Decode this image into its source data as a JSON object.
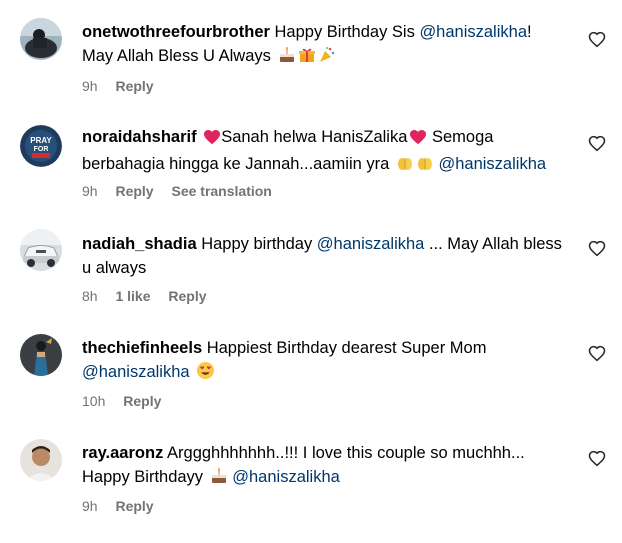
{
  "comments": [
    {
      "username": "onetwothreefourbrother",
      "text_a": "Happy Birthday Sis",
      "mention": "@haniszalikha",
      "text_b": "! May Allah Bless U Always",
      "emojis": [
        "birthday-cake",
        "wrapped-gift",
        "party-popper"
      ],
      "time": "9h",
      "reply": "Reply"
    },
    {
      "username": "noraidahsharif",
      "text_a": "Sanah helwa HanisZalika",
      "text_b": "Semoga berbahagia hingga ke Jannah...aamiin yra",
      "mention": "@haniszalikha",
      "emojis": [
        "red-heart",
        "red-heart",
        "folded-hands",
        "folded-hands"
      ],
      "time": "9h",
      "reply": "Reply",
      "translation": "See translation",
      "avatar_text_1": "PRAY",
      "avatar_text_2": "FOR"
    },
    {
      "username": "nadiah_shadia",
      "text_a": "Happy birthday",
      "mention": "@haniszalikha",
      "text_b": "... May Allah bless u always",
      "time": "8h",
      "likes": "1 like",
      "reply": "Reply"
    },
    {
      "username": "thechiefinheels",
      "text_a": "Happiest Birthday dearest Super Mom",
      "mention": "@haniszalikha",
      "emojis": [
        "smiling-face-with-heart-eyes"
      ],
      "time": "10h",
      "reply": "Reply"
    },
    {
      "username": "ray.aaronz",
      "text_a": "Arggghhhhhhh..!!! I love this couple so muchhh... Happy Birthdayy",
      "mention": "@haniszalikha",
      "emojis": [
        "birthday-cake"
      ],
      "time": "9h",
      "reply": "Reply"
    }
  ],
  "colors": {
    "mention": "#00376b",
    "meta": "#737373",
    "text": "#000000"
  }
}
